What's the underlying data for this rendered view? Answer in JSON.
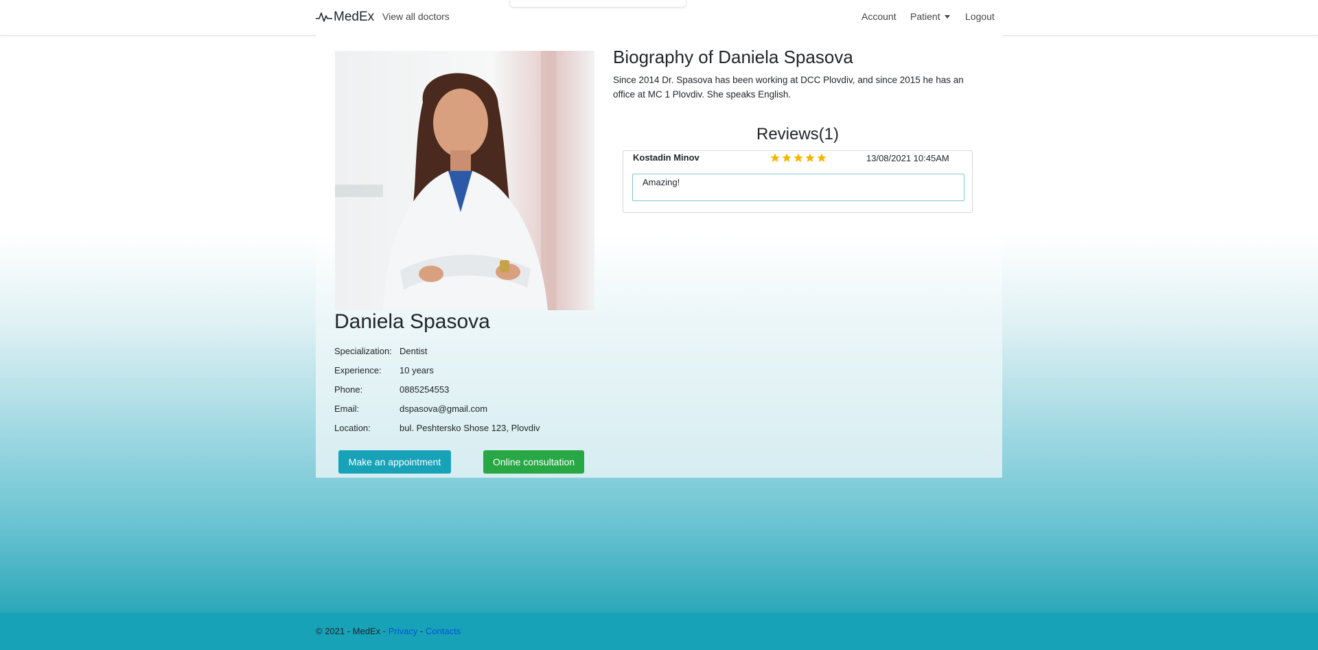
{
  "navbar": {
    "brand": "MedEx",
    "view_all_doctors": "View all doctors",
    "account": "Account",
    "patient": "Patient",
    "logout": "Logout"
  },
  "doctor": {
    "name": "Daniela Spasova",
    "details": [
      {
        "label": "Specialization:",
        "value": "Dentist"
      },
      {
        "label": "Experience:",
        "value": "10 years"
      },
      {
        "label": "Phone:",
        "value": "0885254553"
      },
      {
        "label": "Email:",
        "value": "dspasova@gmail.com"
      },
      {
        "label": "Location:",
        "value": "bul. Peshtersko Shose 123, Plovdiv"
      }
    ],
    "appointment_button": "Make an appointment",
    "consultation_button": "Online consultation"
  },
  "biography": {
    "title": "Biography of Daniela Spasova",
    "text": "Since 2014 Dr. Spasova has been working at DCC Plovdiv, and since 2015 he has an office at MC 1 Plovdiv. She speaks English."
  },
  "reviews": {
    "title": "Reviews(1)",
    "items": [
      {
        "author": "Kostadin Minov",
        "rating": 5,
        "max_rating": 5,
        "date": "13/08/2021 10:45AM",
        "text": "Amazing!"
      }
    ]
  },
  "footer": {
    "copyright": "© 2021 - MedEx -",
    "privacy": "Privacy",
    "separator": "-",
    "contacts": "Contacts"
  },
  "colors": {
    "info": "#17a2b8",
    "success": "#28a745",
    "star": "#f4b400",
    "link": "#0056d6"
  },
  "icons": {
    "brand_icon": "heartbeat-icon",
    "patient_dropdown": "caret-down-icon",
    "rating": "star-icon"
  }
}
